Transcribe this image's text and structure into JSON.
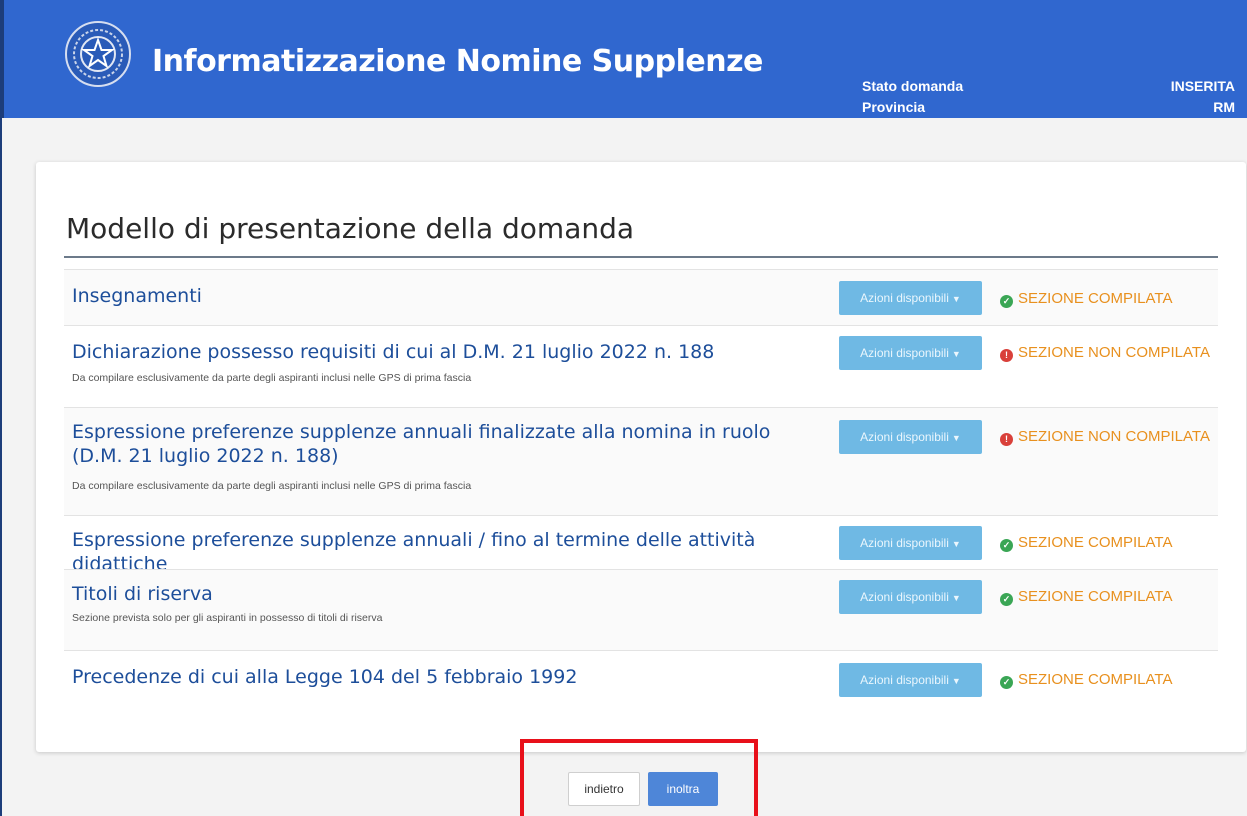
{
  "header": {
    "title": "Informatizzazione Nomine Supplenze",
    "stato_label": "Stato domanda",
    "provincia_label": "Provincia",
    "stato_value": "INSERITA",
    "provincia_value": "RM",
    "emblem_icon": "italian-republic-emblem-icon",
    "bg_color": "#3067cf"
  },
  "card": {
    "title": "Modello di presentazione della domanda"
  },
  "sections": [
    {
      "title": "Insegnamenti",
      "subtitle": "",
      "action_label": "Azioni disponibili",
      "status": "SEZIONE COMPILATA",
      "status_icon": "check-circle-icon"
    },
    {
      "title": "Dichiarazione possesso requisiti di cui al D.M. 21 luglio 2022 n. 188",
      "subtitle": "Da compilare esclusivamente da parte degli aspiranti inclusi nelle GPS di prima fascia",
      "action_label": "Azioni disponibili",
      "status": "SEZIONE NON COMPILATA",
      "status_icon": "error-circle-icon"
    },
    {
      "title": "Espressione preferenze supplenze annuali finalizzate alla nomina in ruolo (D.M. 21 luglio 2022 n. 188)",
      "subtitle": "Da compilare esclusivamente da parte degli aspiranti inclusi nelle GPS di prima fascia",
      "action_label": "Azioni disponibili",
      "status": "SEZIONE NON COMPILATA",
      "status_icon": "error-circle-icon"
    },
    {
      "title": "Espressione preferenze supplenze annuali / fino al termine delle attività didattiche",
      "subtitle": "",
      "action_label": "Azioni disponibili",
      "status": "SEZIONE COMPILATA",
      "status_icon": "check-circle-icon"
    },
    {
      "title": "Titoli di riserva",
      "subtitle": "Sezione prevista solo per gli aspiranti in possesso di titoli di riserva",
      "action_label": "Azioni disponibili",
      "status": "SEZIONE COMPILATA",
      "status_icon": "check-circle-icon"
    },
    {
      "title": "Precedenze di cui alla Legge 104 del 5 febbraio 1992",
      "subtitle": "",
      "action_label": "Azioni disponibili",
      "status": "SEZIONE COMPILATA",
      "status_icon": "check-circle-icon"
    }
  ],
  "footer": {
    "back_label": "indietro",
    "forward_label": "inoltra",
    "highlight_color": "#e8101a"
  },
  "colors": {
    "status_text": "#e8901e",
    "ok_icon": "#3aa655",
    "error_icon": "#d9403a",
    "action_button": "#6fb9e4",
    "link_text": "#1d4e9a"
  }
}
